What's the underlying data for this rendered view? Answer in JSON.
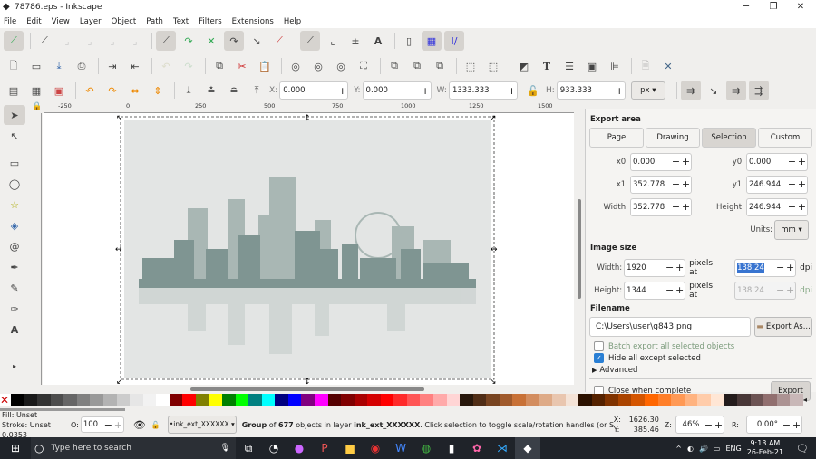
{
  "window": {
    "title": "78786.eps - Inkscape",
    "minimize": "─",
    "maximize": "❐",
    "close": "✕"
  },
  "menu": [
    "File",
    "Edit",
    "View",
    "Layer",
    "Object",
    "Path",
    "Text",
    "Filters",
    "Extensions",
    "Help"
  ],
  "toolbar3": {
    "x_label": "X:",
    "x": "0.000",
    "y_label": "Y:",
    "y": "0.000",
    "w_label": "W:",
    "w": "1333.333",
    "h_label": "H:",
    "h": "933.333",
    "unit": "px"
  },
  "ruler": {
    "h": [
      "-250",
      "0",
      "250",
      "500",
      "750",
      "1000",
      "1250",
      "1500"
    ]
  },
  "export": {
    "area_title": "Export area",
    "tabs": [
      "Page",
      "Drawing",
      "Selection",
      "Custom"
    ],
    "active_tab": "Selection",
    "x0_label": "x0:",
    "x0": "0.000",
    "y0_label": "y0:",
    "y0": "0.000",
    "x1_label": "x1:",
    "x1": "352.778",
    "y1_label": "y1:",
    "y1": "246.944",
    "width_label": "Width:",
    "width": "352.778",
    "height_label": "Height:",
    "height": "246.944",
    "units_label": "Units:",
    "units": "mm",
    "image_size_title": "Image size",
    "img_width_label": "Width:",
    "img_width": "1920",
    "img_height_label": "Height:",
    "img_height": "1344",
    "pixels_at": "pixels at",
    "dpi": "138.24",
    "dpi2": "138.24",
    "dpi_unit": "dpi",
    "filename_title": "Filename",
    "filename": "C:\\Users\\user\\g843.png",
    "export_as": "Export As...",
    "batch": "Batch export all selected objects",
    "batch_checked": false,
    "hide": "Hide all except selected",
    "hide_checked": true,
    "advanced": "Advanced",
    "close_when": "Close when complete",
    "close_checked": false,
    "export": "Export"
  },
  "palette": [
    "#000000",
    "#1a1a1a",
    "#333333",
    "#4d4d4d",
    "#666666",
    "#808080",
    "#999999",
    "#b3b3b3",
    "#cccccc",
    "#e6e6e6",
    "#f2f2f2",
    "#ffffff",
    "#800000",
    "#ff0000",
    "#808000",
    "#ffff00",
    "#008000",
    "#00ff00",
    "#008080",
    "#00ffff",
    "#000080",
    "#0000ff",
    "#800080",
    "#ff00ff",
    "#550000",
    "#800000",
    "#aa0000",
    "#d40000",
    "#ff0000",
    "#ff2a2a",
    "#ff5555",
    "#ff8080",
    "#ffaaaa",
    "#ffd5d5",
    "#28170b",
    "#502d16",
    "#784421",
    "#a05a2c",
    "#c87137",
    "#d38d5f",
    "#deaa87",
    "#e9c6af",
    "#f4e3d7",
    "#2b1100",
    "#552200",
    "#803300",
    "#aa4400",
    "#d45500",
    "#ff6600",
    "#ff7f2a",
    "#ff9955",
    "#ffb380",
    "#ffccaa",
    "#ffe6d5",
    "#241c1c",
    "#483737",
    "#6c5353",
    "#916f6f",
    "#ac9393",
    "#c8b7b7"
  ],
  "status": {
    "fill_label": "Fill:",
    "fill": "Unset",
    "stroke_label": "Stroke:",
    "stroke": "Unset",
    "stroke_width": "0.0353",
    "opacity_label": "O:",
    "opacity": "100",
    "layer": "•ink_ext_XXXXXX",
    "message_pre": "Group",
    "message_mid": " of ",
    "count": "677",
    "message_post": " objects in layer ",
    "layer_name": "ink_ext_XXXXXX",
    "message_end": ". Click selection to toggle scale/rotation handles (or Shift+s).",
    "x_label": "X:",
    "x": "1626.30",
    "y_label": "Y:",
    "y": "385.46",
    "zoom_label": "Z:",
    "zoom": "46%",
    "rot_label": "R:",
    "rotation": "0.00°"
  },
  "taskbar": {
    "search": "Type here to search",
    "lang": "ENG",
    "time": "9:13 AM",
    "date": "26-Feb-21"
  }
}
